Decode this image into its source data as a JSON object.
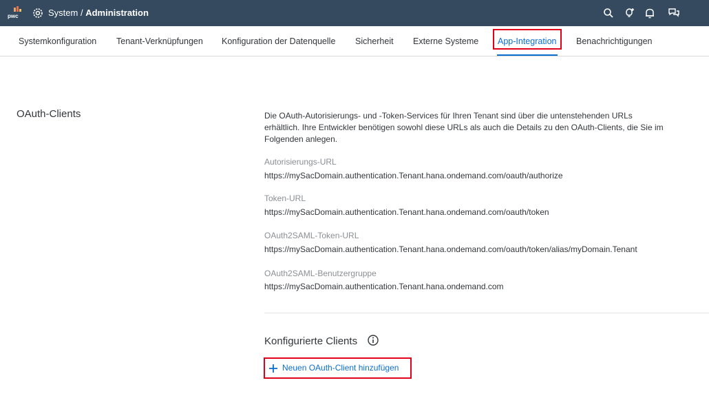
{
  "shell": {
    "logo_text": "pwc",
    "title_prefix": "System / ",
    "title_main": "Administration",
    "actions": [
      "search-icon",
      "lightbulb-icon",
      "bell-icon",
      "chat-icon"
    ]
  },
  "tabs": [
    {
      "label": "Systemkonfiguration",
      "active": false
    },
    {
      "label": "Tenant-Verknüpfungen",
      "active": false
    },
    {
      "label": "Konfiguration der Datenquelle",
      "active": false
    },
    {
      "label": "Sicherheit",
      "active": false
    },
    {
      "label": "Externe Systeme",
      "active": false
    },
    {
      "label": "App-Integration",
      "active": true
    },
    {
      "label": "Benachrichtigungen",
      "active": false
    }
  ],
  "section": {
    "title": "OAuth-Clients",
    "description": "Die OAuth-Autorisierungs- und -Token-Services für Ihren Tenant sind über die untenstehenden URLs erhältlich. Ihre Entwickler benötigen sowohl diese URLs als auch die Details zu den OAuth-Clients, die Sie im Folgenden anlegen.",
    "fields": [
      {
        "label": "Autorisierungs-URL",
        "value": "https://mySacDomain.authentication.Tenant.hana.ondemand.com/oauth/authorize"
      },
      {
        "label": "Token-URL",
        "value": "https://mySacDomain.authentication.Tenant.hana.ondemand.com/oauth/token"
      },
      {
        "label": "OAuth2SAML-Token-URL",
        "value": "https://mySacDomain.authentication.Tenant.hana.ondemand.com/oauth/token/alias/myDomain.Tenant"
      },
      {
        "label": "OAuth2SAML-Benutzergruppe",
        "value": "https://mySacDomain.authentication.Tenant.hana.ondemand.com"
      }
    ],
    "configured_clients_title": "Konfigurierte Clients",
    "add_client_label": "Neuen OAuth-Client hinzufügen"
  },
  "colors": {
    "shell_bg": "#354a5f",
    "accent": "#0a6ed1",
    "highlight": "#e0001a"
  }
}
